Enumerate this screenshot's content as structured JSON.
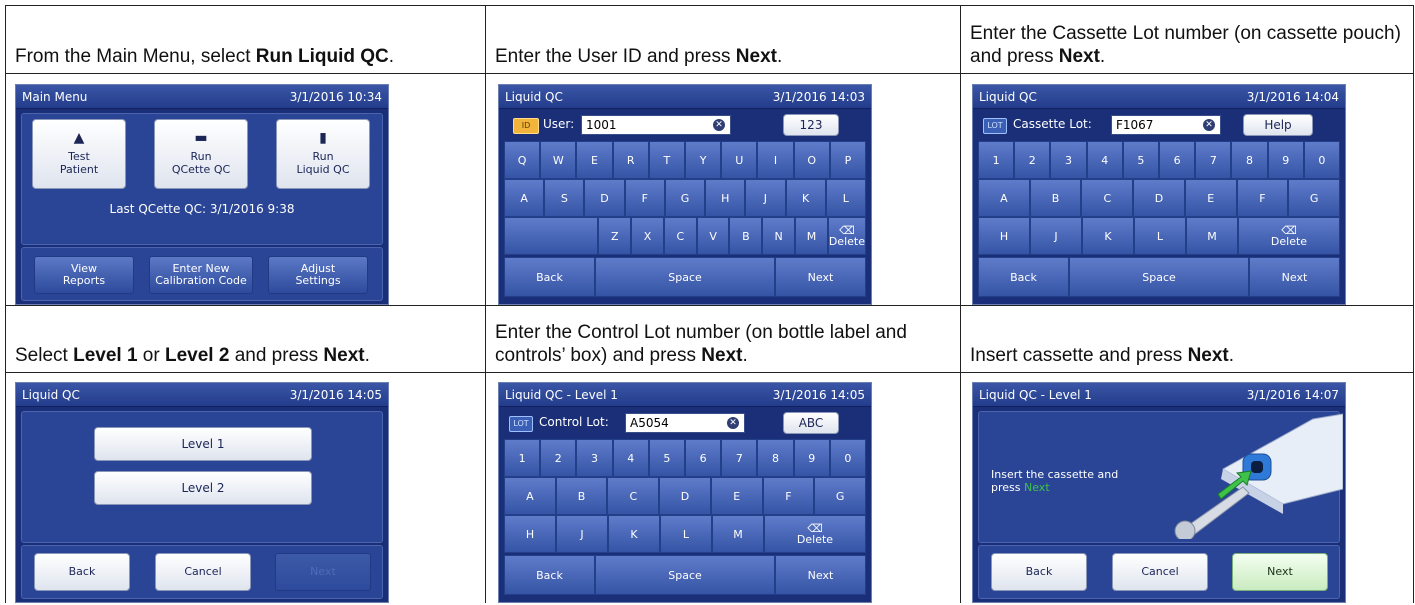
{
  "captions": [
    {
      "pre": "From the Main Menu, select ",
      "b1": "Run Liquid QC",
      "mid": ".",
      "b2": "",
      "post": ""
    },
    {
      "pre": "Enter the User ID and press ",
      "b1": "Next",
      "mid": ".",
      "b2": "",
      "post": ""
    },
    {
      "pre": "Enter the Cassette Lot number (on cassette pouch) and press ",
      "b1": "Next",
      "mid": ".",
      "b2": "",
      "post": ""
    },
    {
      "pre": "Select ",
      "b1": "Level 1",
      "mid": " or ",
      "b2": "Level 2",
      "post": " and press "
    },
    {
      "pre": "Enter the Control Lot number (on bottle label and controls’ box) and press ",
      "b1": "Next",
      "mid": ".",
      "b2": "",
      "post": ""
    },
    {
      "pre": "Insert cassette and press ",
      "b1": "Next",
      "mid": ".",
      "b2": "",
      "post": ""
    }
  ],
  "caption4_tail": {
    "b": "Next",
    "end": "."
  },
  "screen1": {
    "title": "Main Menu",
    "time": "3/1/2016 10:34",
    "tiles": [
      {
        "l1": "Test",
        "l2": "Patient"
      },
      {
        "l1": "Run",
        "l2": "QCette QC"
      },
      {
        "l1": "Run",
        "l2": "Liquid QC"
      }
    ],
    "last": "Last QCette QC: 3/1/2016 9:38",
    "bottom": [
      {
        "l1": "View",
        "l2": "Reports"
      },
      {
        "l1": "Enter New",
        "l2": "Calibration Code"
      },
      {
        "l1": "Adjust",
        "l2": "Settings"
      }
    ]
  },
  "screen2": {
    "title": "Liquid QC",
    "time": "3/1/2016 14:03",
    "field_label": "User:",
    "value": "1001",
    "mode": "123",
    "row1": [
      "Q",
      "W",
      "E",
      "R",
      "T",
      "Y",
      "U",
      "I",
      "O",
      "P"
    ],
    "row2": [
      "A",
      "S",
      "D",
      "F",
      "G",
      "H",
      "J",
      "K",
      "L"
    ],
    "row3": [
      "Z",
      "X",
      "C",
      "V",
      "B",
      "N",
      "M"
    ],
    "delete": "Delete",
    "back": "Back",
    "space": "Space",
    "next": "Next"
  },
  "screen3": {
    "title": "Liquid QC",
    "time": "3/1/2016 14:04",
    "badge": "LOT",
    "field_label": "Cassette Lot:",
    "value": "F1067",
    "help": "Help",
    "row1": [
      "1",
      "2",
      "3",
      "4",
      "5",
      "6",
      "7",
      "8",
      "9",
      "0"
    ],
    "row2": [
      "A",
      "B",
      "C",
      "D",
      "E",
      "F",
      "G"
    ],
    "row3": [
      "H",
      "J",
      "K",
      "L",
      "M"
    ],
    "delete": "Delete",
    "back": "Back",
    "space": "Space",
    "next": "Next"
  },
  "screen4": {
    "title": "Liquid QC",
    "time": "3/1/2016 14:05",
    "level1": "Level 1",
    "level2": "Level 2",
    "back": "Back",
    "cancel": "Cancel",
    "next": "Next"
  },
  "screen5": {
    "title": "Liquid QC - Level 1",
    "time": "3/1/2016 14:05",
    "badge": "LOT",
    "field_label": "Control Lot:",
    "value": "A5054",
    "mode": "ABC",
    "row1": [
      "1",
      "2",
      "3",
      "4",
      "5",
      "6",
      "7",
      "8",
      "9",
      "0"
    ],
    "row2": [
      "A",
      "B",
      "C",
      "D",
      "E",
      "F",
      "G"
    ],
    "row3": [
      "H",
      "J",
      "K",
      "L",
      "M"
    ],
    "delete": "Delete",
    "back": "Back",
    "space": "Space",
    "next": "Next"
  },
  "screen6": {
    "title": "Liquid QC - Level 1",
    "time": "3/1/2016 14:07",
    "msg1": "Insert the cassette and",
    "msg2": "press ",
    "msg_next": "Next",
    "back": "Back",
    "cancel": "Cancel",
    "next": "Next"
  }
}
